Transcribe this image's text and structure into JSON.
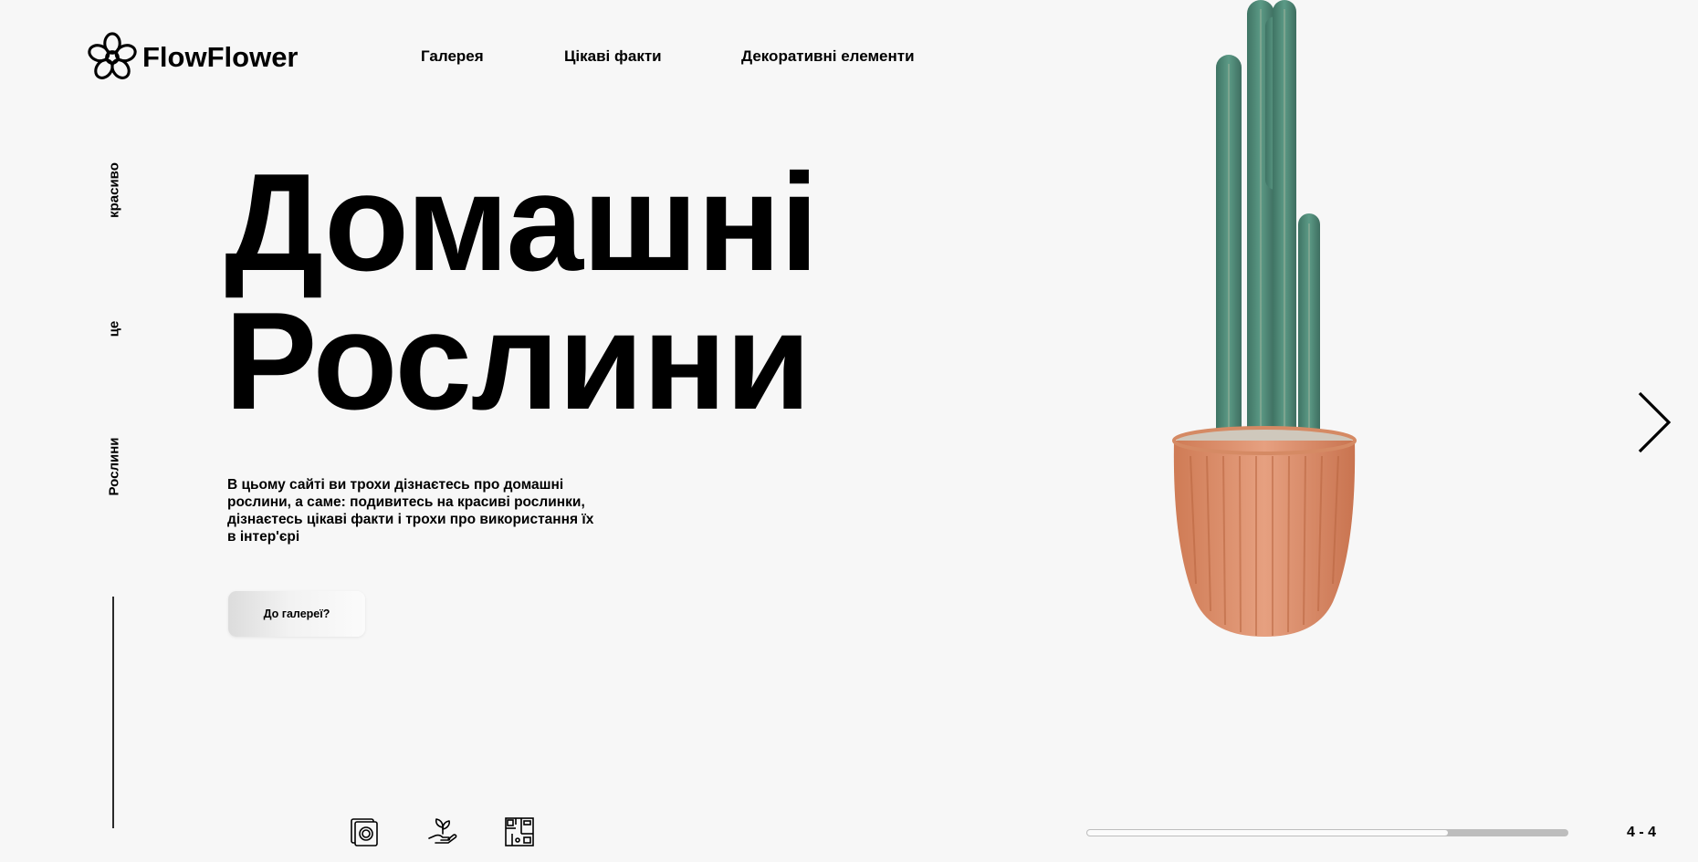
{
  "brand": {
    "name": "FlowFlower",
    "logo_icon": "flower-icon"
  },
  "nav": {
    "items": [
      {
        "label": "Галерея"
      },
      {
        "label": "Цікаві факти"
      },
      {
        "label": "Декоративні елементи"
      }
    ]
  },
  "side": {
    "words": [
      "красиво",
      "це",
      "Рослини"
    ]
  },
  "hero": {
    "title_line1": "Домашні",
    "title_line2": "Рослини",
    "description": "В цьому сайті ви трохи дізнаєтесь про домашні рослини, а саме: подивитесь на красиві рослинки, дізнаєтесь цікаві факти і трохи про використання їх в інтер'єрі",
    "cta_label": "До галереї?"
  },
  "image": {
    "subject": "cactus-in-terracotta-pot"
  },
  "navigation": {
    "next_icon": "chevron-right-icon"
  },
  "bottom_icons": [
    {
      "name": "gallery-cards-icon"
    },
    {
      "name": "plant-in-hand-icon"
    },
    {
      "name": "interior-floorplan-icon"
    }
  ],
  "slider": {
    "progress": 0.75,
    "counter": "4 - 4"
  },
  "colors": {
    "background": "#f7f7f7",
    "text": "#000000",
    "progress_track": "#bdbdbd",
    "progress_fill": "#fbfbfb",
    "pot": "#e0906a",
    "cactus": "#4f8a78"
  }
}
